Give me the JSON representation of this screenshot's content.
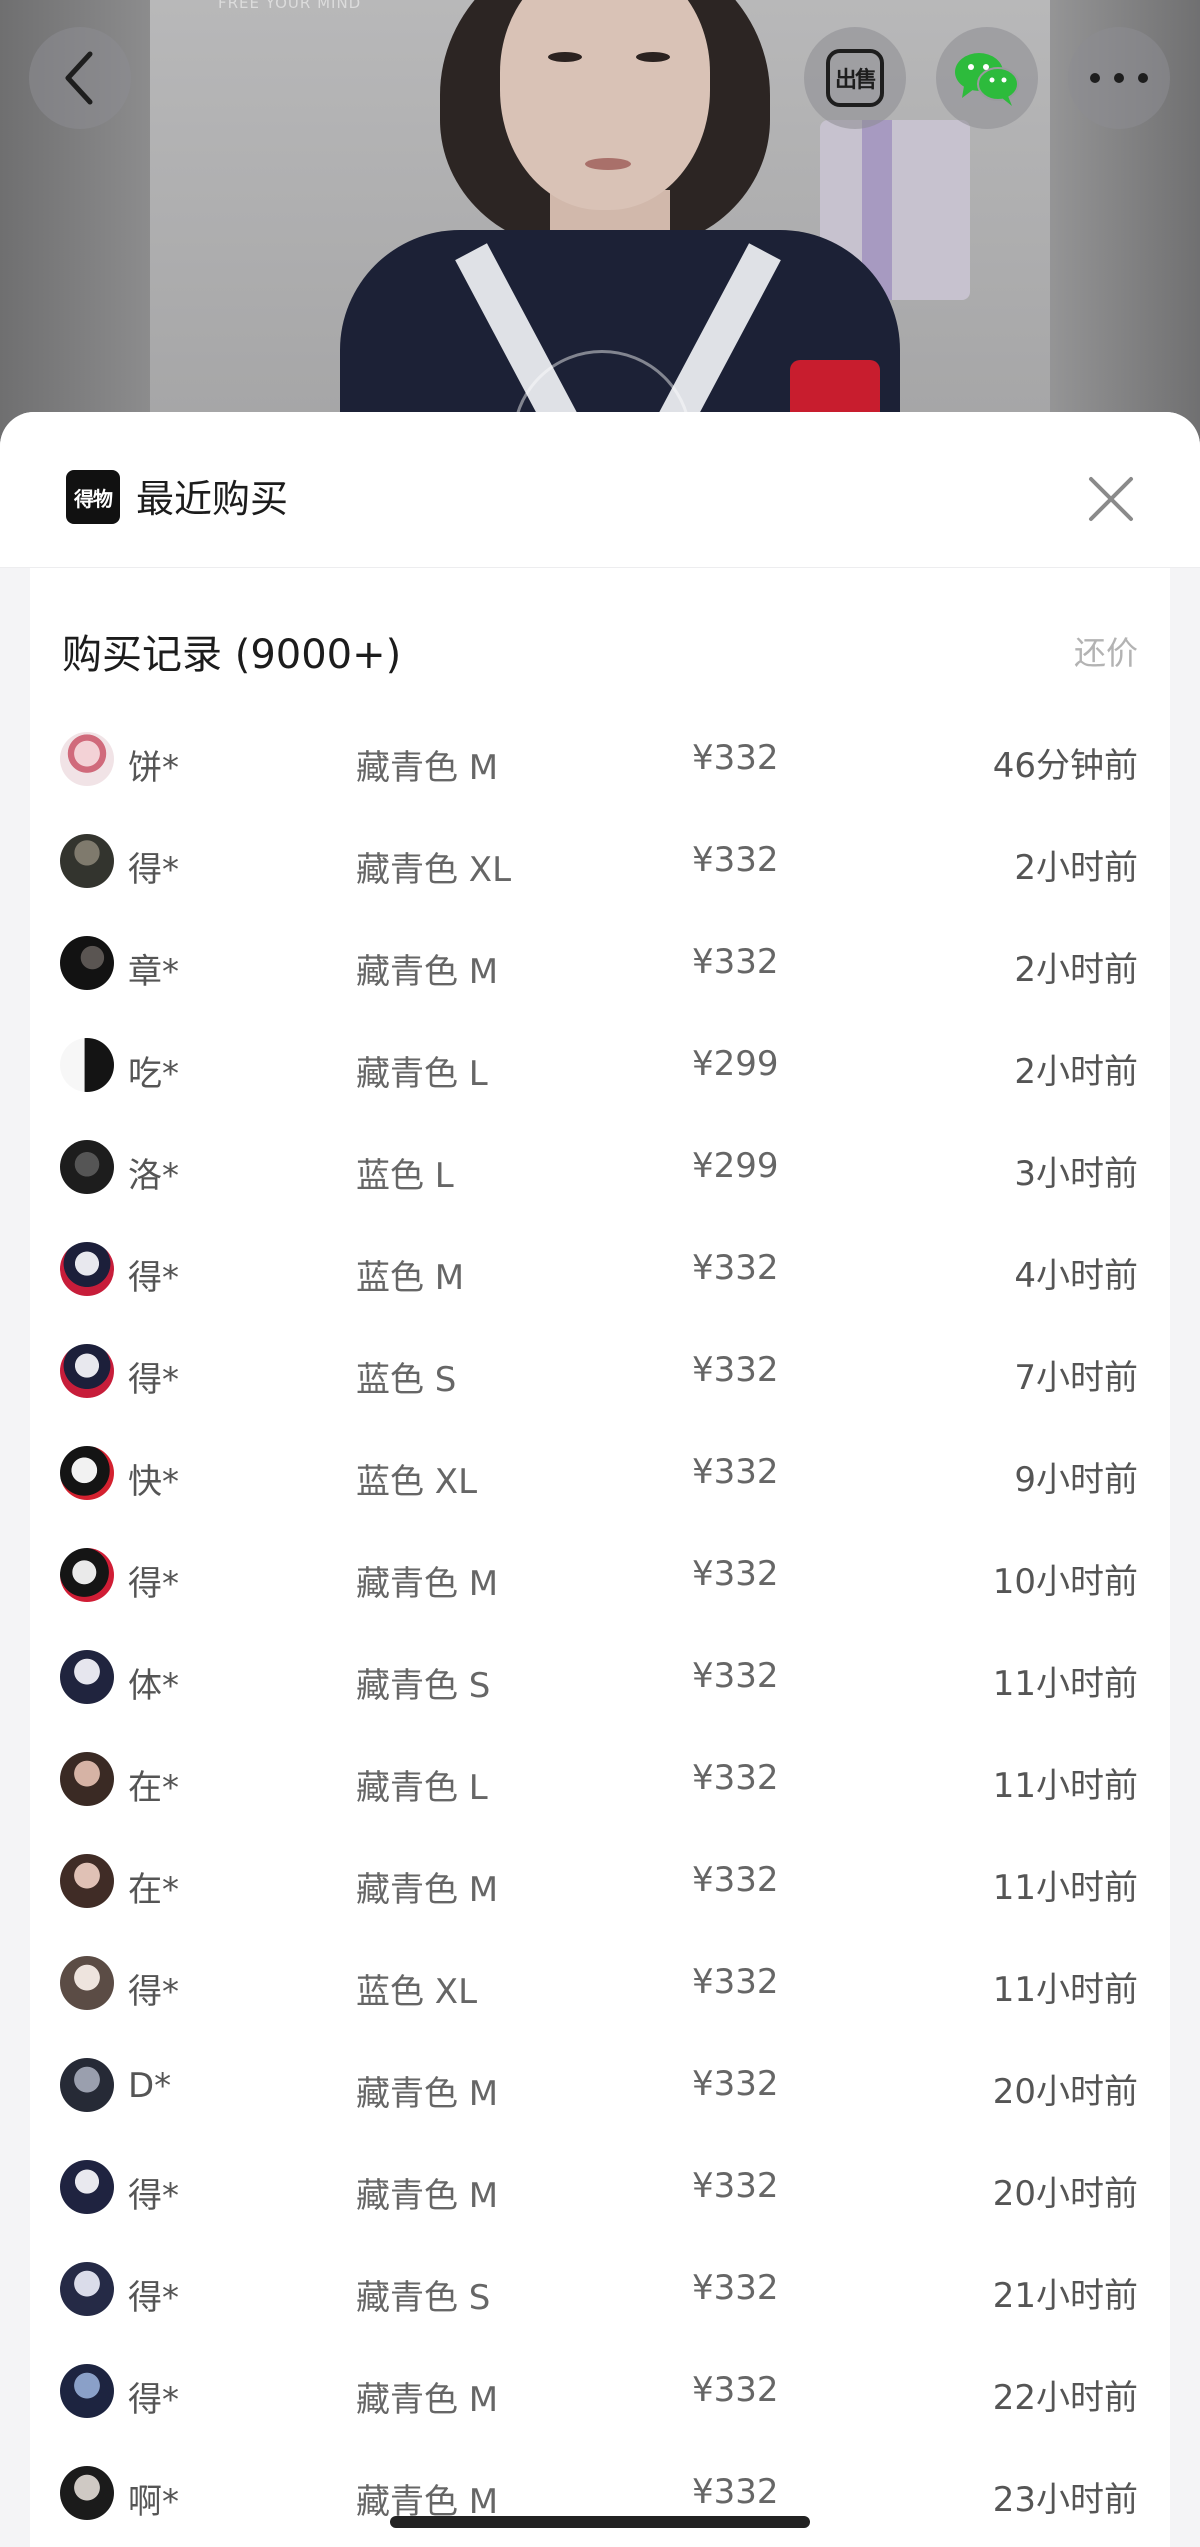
{
  "hero": {
    "brand_text": "FREE YOUR MIND"
  },
  "top_actions": {
    "back_icon": "chevron-left-icon",
    "sell_label": "出售",
    "share_icon": "wechat-icon",
    "more_icon": "more-dots-icon"
  },
  "sheet": {
    "app_logo": "得物",
    "title": "最近购买",
    "close_icon": "close-icon"
  },
  "records": {
    "title": "购买记录 (9000+)",
    "bargain_label": "还价",
    "rows": [
      {
        "user": "饼*",
        "spec": "藏青色 M",
        "price": "¥332",
        "time": "46分钟前"
      },
      {
        "user": "得*",
        "spec": "藏青色 XL",
        "price": "¥332",
        "time": "2小时前"
      },
      {
        "user": "章*",
        "spec": "藏青色 M",
        "price": "¥332",
        "time": "2小时前"
      },
      {
        "user": "吃*",
        "spec": "藏青色 L",
        "price": "¥299",
        "time": "2小时前"
      },
      {
        "user": "洛*",
        "spec": "蓝色 L",
        "price": "¥299",
        "time": "3小时前"
      },
      {
        "user": "得*",
        "spec": "蓝色 M",
        "price": "¥332",
        "time": "4小时前"
      },
      {
        "user": "得*",
        "spec": "蓝色 S",
        "price": "¥332",
        "time": "7小时前"
      },
      {
        "user": "快*",
        "spec": "蓝色 XL",
        "price": "¥332",
        "time": "9小时前"
      },
      {
        "user": "得*",
        "spec": "藏青色 M",
        "price": "¥332",
        "time": "10小时前"
      },
      {
        "user": "体*",
        "spec": "藏青色 S",
        "price": "¥332",
        "time": "11小时前"
      },
      {
        "user": "在*",
        "spec": "藏青色 L",
        "price": "¥332",
        "time": "11小时前"
      },
      {
        "user": "在*",
        "spec": "藏青色 M",
        "price": "¥332",
        "time": "11小时前"
      },
      {
        "user": "得*",
        "spec": "蓝色 XL",
        "price": "¥332",
        "time": "11小时前"
      },
      {
        "user": "D*",
        "spec": "藏青色 M",
        "price": "¥332",
        "time": "20小时前"
      },
      {
        "user": "得*",
        "spec": "藏青色 M",
        "price": "¥332",
        "time": "20小时前"
      },
      {
        "user": "得*",
        "spec": "藏青色 S",
        "price": "¥332",
        "time": "21小时前"
      },
      {
        "user": "得*",
        "spec": "藏青色 M",
        "price": "¥332",
        "time": "22小时前"
      },
      {
        "user": "啊*",
        "spec": "藏青色 M",
        "price": "¥332",
        "time": "23小时前"
      }
    ]
  },
  "colors": {
    "sheet_bg": "#f4f4f6",
    "card_bg": "#ffffff",
    "muted_text": "#b3b3b3",
    "wechat_green": "#2dbb3c"
  }
}
